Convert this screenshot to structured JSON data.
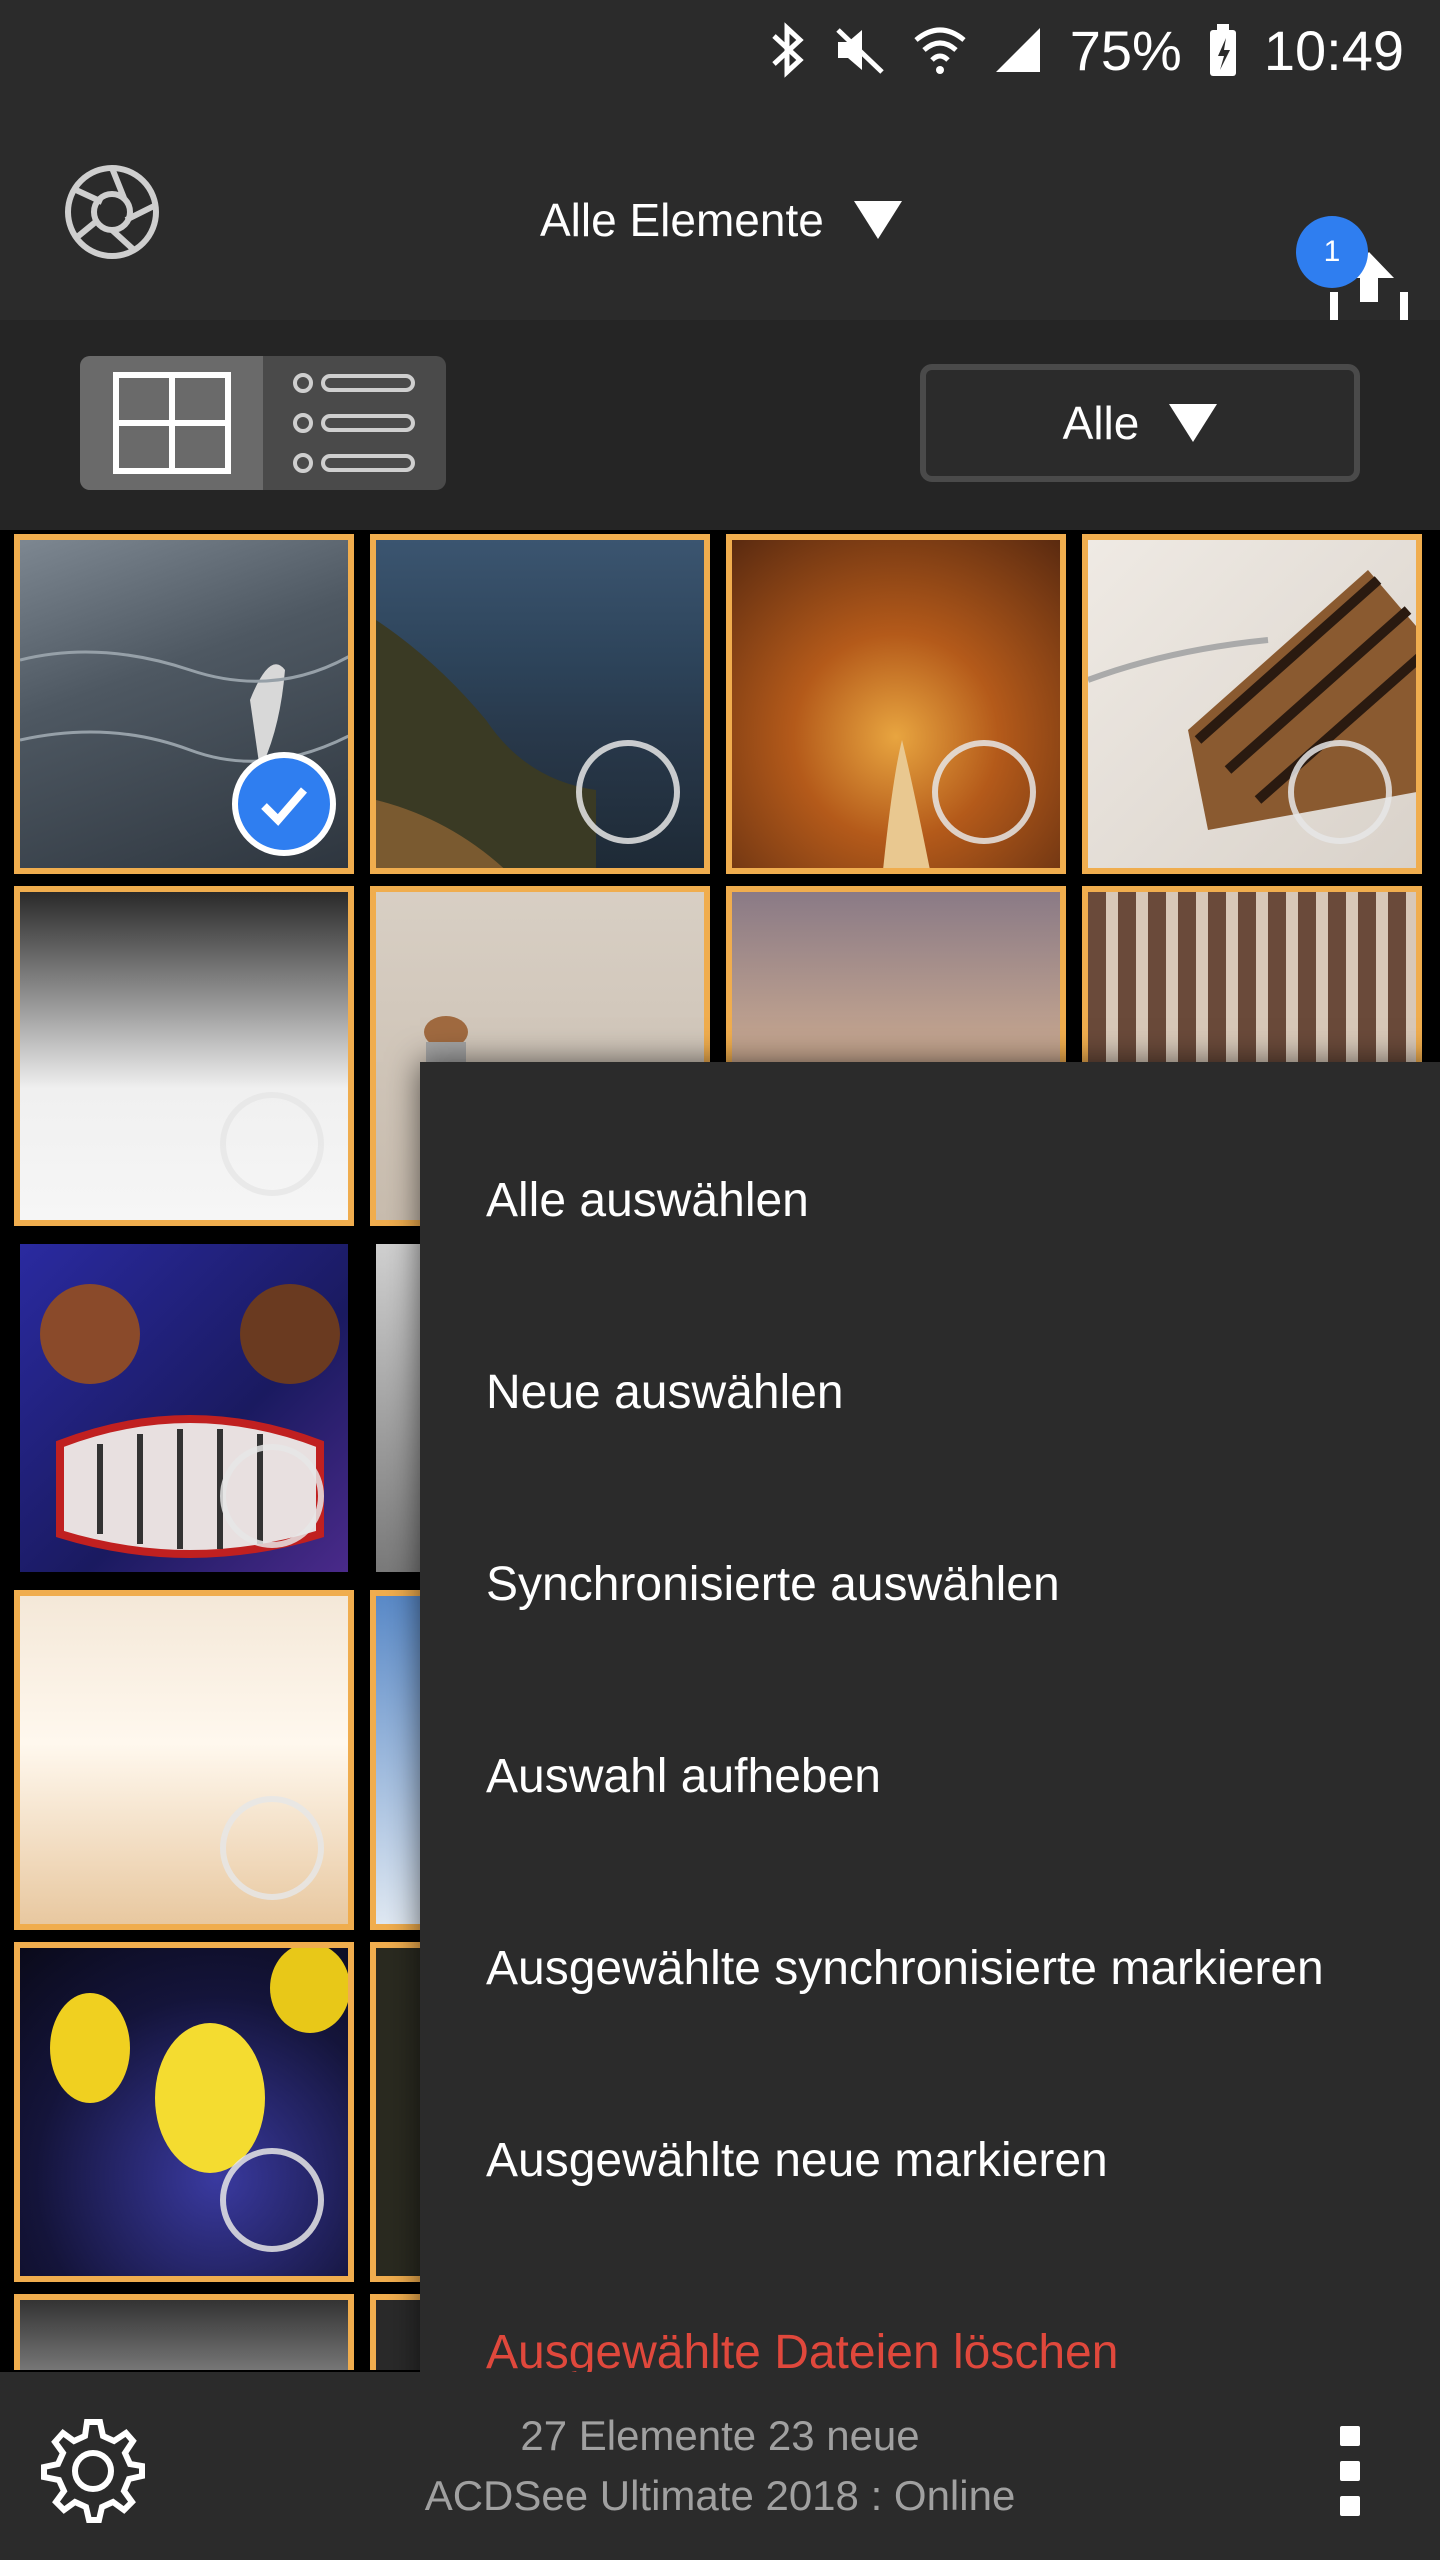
{
  "status_bar": {
    "battery_percent": "75%",
    "time": "10:49",
    "icons": [
      "bluetooth-icon",
      "mute-icon",
      "wifi-icon",
      "signal-icon",
      "battery-icon"
    ]
  },
  "app_bar": {
    "collection_label": "Alle Elemente",
    "upload_badge": "1"
  },
  "toolbar": {
    "filter_label": "Alle",
    "view_modes": [
      "grid-view",
      "list-view"
    ],
    "active_view": "grid-view"
  },
  "grid": {
    "thumbnails": [
      {
        "name": "sea-bird",
        "selected": true
      },
      {
        "name": "coast",
        "selected": false
      },
      {
        "name": "autumn-forest",
        "selected": false
      },
      {
        "name": "cake",
        "selected": false
      },
      {
        "name": "snow",
        "selected": false
      },
      {
        "name": "person-beach",
        "selected": false
      },
      {
        "name": "sunset",
        "selected": false
      },
      {
        "name": "building",
        "selected": false
      },
      {
        "name": "graffiti-face",
        "selected": false
      },
      {
        "name": "snowy-trees",
        "selected": false
      },
      {
        "name": "interior",
        "selected": false
      },
      {
        "name": "sky",
        "selected": false
      },
      {
        "name": "yellow-tulips",
        "selected": false
      },
      {
        "name": "dark-photo",
        "selected": false
      }
    ]
  },
  "menu": {
    "items": [
      {
        "label": "Alle auswählen"
      },
      {
        "label": "Neue auswählen"
      },
      {
        "label": "Synchronisierte auswählen"
      },
      {
        "label": "Auswahl aufheben"
      },
      {
        "label": "Ausgewählte synchronisierte markieren"
      },
      {
        "label": "Ausgewählte neue markieren"
      },
      {
        "label": "Ausgewählte Dateien löschen",
        "danger": true
      }
    ],
    "danger_color": "#e0483c"
  },
  "bottom_bar": {
    "count_text": "27 Elemente  23 neue",
    "source_text": "ACDSee Ultimate 2018 : Online"
  },
  "colors": {
    "accent_border": "#f0ad4e",
    "selection_blue": "#2f7ef0",
    "bar_background": "#2b2b2b"
  }
}
